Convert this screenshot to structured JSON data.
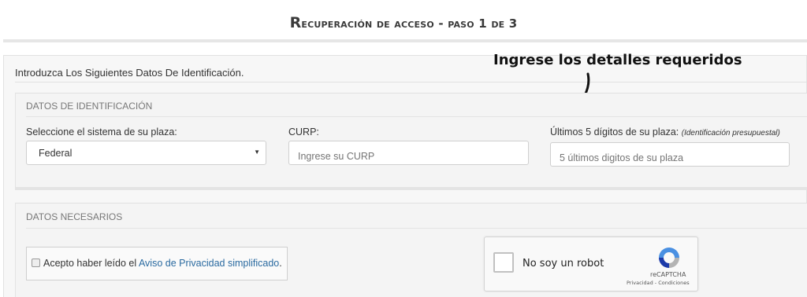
{
  "page": {
    "title_first_letter": "R",
    "title_rest": "ecuperación de acceso - paso 1 de 3"
  },
  "intro": "Introduzca Los Siguientes Datos De Identificación.",
  "annotation": {
    "text": "Ingrese los detalles requeridos",
    "icon": "curved-arrow-icon"
  },
  "identification": {
    "legend": "DATOS DE IDENTIFICACIÓN",
    "system_label": "Seleccione el sistema de su plaza:",
    "system_value": "Federal",
    "system_caret": "▼",
    "curp_label": "CURP:",
    "curp_placeholder": "Ingrese su CURP",
    "plaza_label": "Últimos 5 dígitos de su plaza:",
    "plaza_hint": "(Identificación presupuestal)",
    "plaza_placeholder": "5 últimos digitos de su plaza"
  },
  "required": {
    "legend": "DATOS NECESARIOS",
    "privacy_prefix": "Acepto haber leído el ",
    "privacy_link": "Aviso de Privacidad simplificado",
    "privacy_suffix": ".",
    "captcha_label": "No soy un robot",
    "captcha_brand": "reCAPTCHA",
    "captcha_links": "Privacidad - Condiciones"
  },
  "colors": {
    "link": "#2a6aa0",
    "panel": "#f7f7f7",
    "captcha_blue": "#4a90e2",
    "captcha_gray": "#b3b3b3"
  }
}
